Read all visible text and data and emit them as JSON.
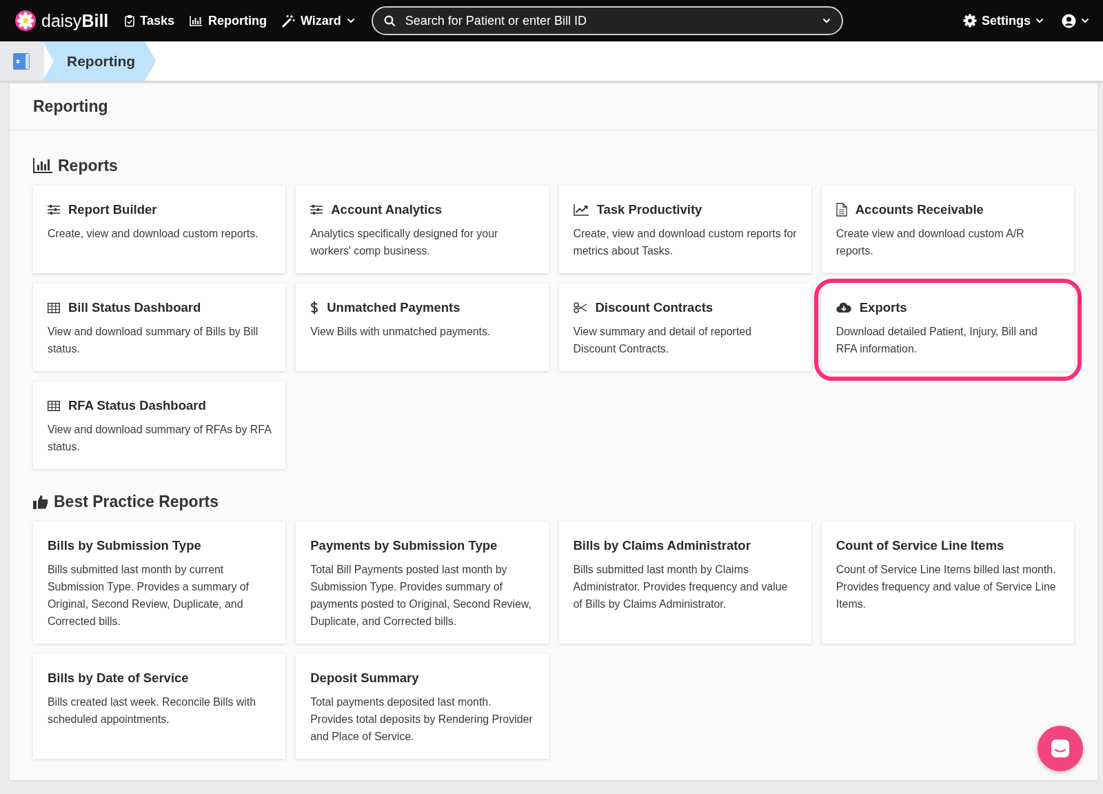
{
  "navbar": {
    "brand_light": "daisy",
    "brand_bold": "Bill",
    "items": [
      {
        "label": "Tasks",
        "dropdown": false
      },
      {
        "label": "Reporting",
        "dropdown": false
      },
      {
        "label": "Wizard",
        "dropdown": true
      }
    ],
    "search": {
      "placeholder": "Search for Patient or enter Bill ID"
    },
    "settings": {
      "label": "Settings"
    }
  },
  "breadcrumb": [
    {
      "label": "Reporting"
    }
  ],
  "page": {
    "title": "Reporting"
  },
  "sections": [
    {
      "title": "Reports",
      "cards": [
        {
          "title": "Report Builder",
          "description": "Create, view and download custom reports.",
          "highlighted": false
        },
        {
          "title": "Account Analytics",
          "description": "Analytics specifically designed for your workers' comp business.",
          "highlighted": false
        },
        {
          "title": "Task Productivity",
          "description": "Create, view and download custom reports for metrics about Tasks.",
          "highlighted": false
        },
        {
          "title": "Accounts Receivable",
          "description": "Create view and download custom A/R reports.",
          "highlighted": false
        },
        {
          "title": "Bill Status Dashboard",
          "description": "View and download summary of Bills by Bill status.",
          "highlighted": false
        },
        {
          "title": "Unmatched Payments",
          "description": "View Bills with unmatched payments.",
          "highlighted": false
        },
        {
          "title": "Discount Contracts",
          "description": "View summary and detail of reported Discount Contracts.",
          "highlighted": false
        },
        {
          "title": "Exports",
          "description": "Download detailed Patient, Injury, Bill and RFA information.",
          "highlighted": true
        },
        {
          "title": "RFA Status Dashboard",
          "description": "View and download summary of RFAs by RFA status.",
          "highlighted": false
        }
      ]
    },
    {
      "title": "Best Practice Reports",
      "cards": [
        {
          "title": "Bills by Submission Type",
          "description": "Bills submitted last month by current Submission Type. Provides a summary of Original, Second Review, Duplicate, and Corrected bills.",
          "highlighted": false
        },
        {
          "title": "Payments by Submission Type",
          "description": "Total Bill Payments posted last month by Submission Type. Provides summary of payments posted to Original, Second Review, Duplicate, and Corrected bills.",
          "highlighted": false
        },
        {
          "title": "Bills by Claims Administrator",
          "description": "Bills submitted last month by Claims Administrator. Provides frequency and value of Bills by Claims Administrator.",
          "highlighted": false
        },
        {
          "title": "Count of Service Line Items",
          "description": "Count of Service Line Items billed last month. Provides frequency and value of Service Line Items.",
          "highlighted": false
        },
        {
          "title": "Bills by Date of Service",
          "description": "Bills created last week. Reconcile Bills with scheduled appointments.",
          "highlighted": false
        },
        {
          "title": "Deposit Summary",
          "description": "Total payments deposited last month. Provides total deposits by Rendering Provider and Place of Service.",
          "highlighted": false
        }
      ]
    }
  ]
}
